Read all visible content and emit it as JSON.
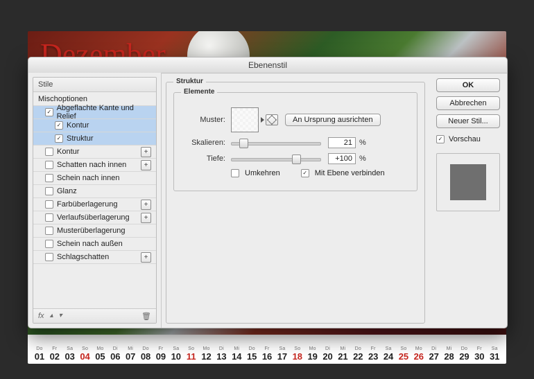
{
  "background": {
    "month": "Dezember",
    "weekdays": [
      "Do",
      "Fr",
      "Sa",
      "So",
      "Mo",
      "Di",
      "Mi",
      "Do",
      "Fr",
      "Sa",
      "So",
      "Mo",
      "Di",
      "Mi",
      "Do",
      "Fr",
      "Sa",
      "So",
      "Mo",
      "Di",
      "Mi",
      "Do",
      "Fr",
      "Sa",
      "So",
      "Mo",
      "Di",
      "Mi",
      "Do",
      "Fr",
      "Sa"
    ],
    "days": [
      "01",
      "02",
      "03",
      "04",
      "05",
      "06",
      "07",
      "08",
      "09",
      "10",
      "11",
      "12",
      "13",
      "14",
      "15",
      "16",
      "17",
      "18",
      "19",
      "20",
      "21",
      "22",
      "23",
      "24",
      "25",
      "26",
      "27",
      "28",
      "29",
      "30",
      "31"
    ],
    "red_days": [
      "04",
      "11",
      "18",
      "25",
      "26"
    ]
  },
  "dialog": {
    "title": "Ebenenstil",
    "left": {
      "header": "Stile",
      "blending": "Mischoptionen",
      "items": [
        {
          "label": "Abgeflachte Kante und Relief",
          "checked": true,
          "selected": true,
          "plus": false,
          "indent": 1
        },
        {
          "label": "Kontur",
          "checked": true,
          "selected": true,
          "plus": false,
          "indent": 2
        },
        {
          "label": "Struktur",
          "checked": true,
          "selected": true,
          "plus": false,
          "indent": 2
        },
        {
          "label": "Kontur",
          "checked": false,
          "selected": false,
          "plus": true,
          "indent": 1
        },
        {
          "label": "Schatten nach innen",
          "checked": false,
          "selected": false,
          "plus": true,
          "indent": 1
        },
        {
          "label": "Schein nach innen",
          "checked": false,
          "selected": false,
          "plus": false,
          "indent": 1
        },
        {
          "label": "Glanz",
          "checked": false,
          "selected": false,
          "plus": false,
          "indent": 1
        },
        {
          "label": "Farbüberlagerung",
          "checked": false,
          "selected": false,
          "plus": true,
          "indent": 1
        },
        {
          "label": "Verlaufsüberlagerung",
          "checked": false,
          "selected": false,
          "plus": true,
          "indent": 1
        },
        {
          "label": "Musterüberlagerung",
          "checked": false,
          "selected": false,
          "plus": false,
          "indent": 1
        },
        {
          "label": "Schein nach außen",
          "checked": false,
          "selected": false,
          "plus": false,
          "indent": 1
        },
        {
          "label": "Schlagschatten",
          "checked": false,
          "selected": false,
          "plus": true,
          "indent": 1
        }
      ],
      "footer_fx": "fx"
    },
    "center": {
      "group": "Struktur",
      "subgroup": "Elemente",
      "pattern_label": "Muster:",
      "snap_button": "An Ursprung ausrichten",
      "scale_label": "Skalieren:",
      "scale_value": "21",
      "scale_unit": "%",
      "depth_label": "Tiefe:",
      "depth_value": "+100",
      "depth_unit": "%",
      "invert_label": "Umkehren",
      "invert_checked": false,
      "link_label": "Mit Ebene verbinden",
      "link_checked": true
    },
    "right": {
      "ok": "OK",
      "cancel": "Abbrechen",
      "new_style": "Neuer Stil...",
      "preview_label": "Vorschau",
      "preview_checked": true
    }
  }
}
